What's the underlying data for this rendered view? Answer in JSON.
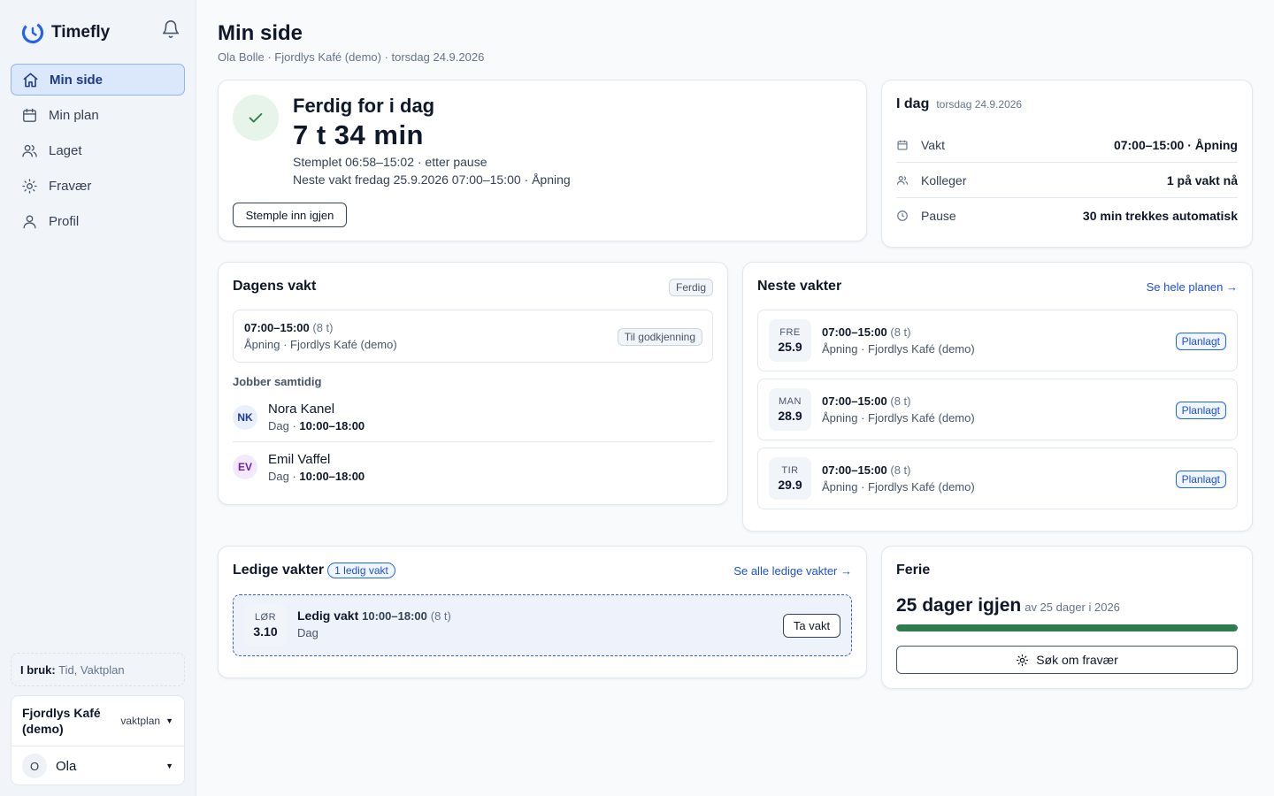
{
  "app": {
    "name": "Timefly"
  },
  "sidebar": {
    "items": [
      {
        "label": "Min side",
        "icon": "home-icon",
        "active": true
      },
      {
        "label": "Min plan",
        "icon": "calendar-icon"
      },
      {
        "label": "Laget",
        "icon": "users-icon"
      },
      {
        "label": "Fravær",
        "icon": "sun-icon"
      },
      {
        "label": "Profil",
        "icon": "user-icon"
      }
    ],
    "inuse_label": "I bruk:",
    "inuse_value": "Tid, Vaktplan",
    "org_name": "Fjordlys Kafé (demo)",
    "org_mode": "vaktplan",
    "user_initial": "O",
    "user_name": "Ola"
  },
  "header": {
    "title": "Min side",
    "subtitle": "Ola Bolle · Fjordlys Kafé (demo) · torsdag 24.9.2026"
  },
  "status": {
    "heading": "Ferdig for i dag",
    "duration": "7 t 34 min",
    "stamped": "Stemplet 06:58–15:02 · etter pause",
    "next": "Neste vakt fredag 25.9.2026 07:00–15:00 · Åpning",
    "button": "Stemple inn igjen"
  },
  "today": {
    "title": "I dag",
    "date": "torsdag 24.9.2026",
    "rows": [
      {
        "label": "Vakt",
        "value": "07:00–15:00 · Åpning",
        "icon": "calendar-icon"
      },
      {
        "label": "Kolleger",
        "value": "1 på vakt nå",
        "icon": "users-icon"
      },
      {
        "label": "Pause",
        "value": "30 min trekkes automatisk",
        "icon": "clock-icon"
      }
    ]
  },
  "day_shift": {
    "title": "Dagens vakt",
    "badge": "Ferdig",
    "time": "07:00–15:00",
    "hours": "(8 t)",
    "place": "Åpning · Fjordlys Kafé (demo)",
    "status": "Til godkjenning",
    "colleagues_title": "Jobber samtidig",
    "colleagues": [
      {
        "initials": "NK",
        "name": "Nora Kanel",
        "type": "Dag ·",
        "time": "10:00–18:00"
      },
      {
        "initials": "EV",
        "name": "Emil Vaffel",
        "type": "Dag ·",
        "time": "10:00–18:00"
      }
    ]
  },
  "next_shifts": {
    "title": "Neste vakter",
    "link": "Se hele planen →",
    "items": [
      {
        "dow": "FRE",
        "day": "25.9",
        "time": "07:00–15:00",
        "hours": "(8 t)",
        "place": "Åpning · Fjordlys Kafé (demo)",
        "status": "Planlagt"
      },
      {
        "dow": "MAN",
        "day": "28.9",
        "time": "07:00–15:00",
        "hours": "(8 t)",
        "place": "Åpning · Fjordlys Kafé (demo)",
        "status": "Planlagt"
      },
      {
        "dow": "TIR",
        "day": "29.9",
        "time": "07:00–15:00",
        "hours": "(8 t)",
        "place": "Åpning · Fjordlys Kafé (demo)",
        "status": "Planlagt"
      }
    ]
  },
  "open_shifts": {
    "title": "Ledige vakter",
    "count_badge": "1 ledig vakt",
    "link": "Se alle ledige vakter →",
    "item": {
      "dow": "LØR",
      "day": "3.10",
      "title": "Ledig vakt",
      "time": "10:00–18:00",
      "hours": "(8 t)",
      "type": "Dag",
      "button": "Ta vakt"
    }
  },
  "vacation": {
    "title": "Ferie",
    "remaining": "25 dager igjen",
    "of_total": "av 25 dager i 2026",
    "progress": 1.0,
    "button": "Søk om fravær"
  },
  "colors": {
    "accent": "#1d4ed8",
    "success": "#2e7d4f",
    "brand": "#2563eb"
  }
}
